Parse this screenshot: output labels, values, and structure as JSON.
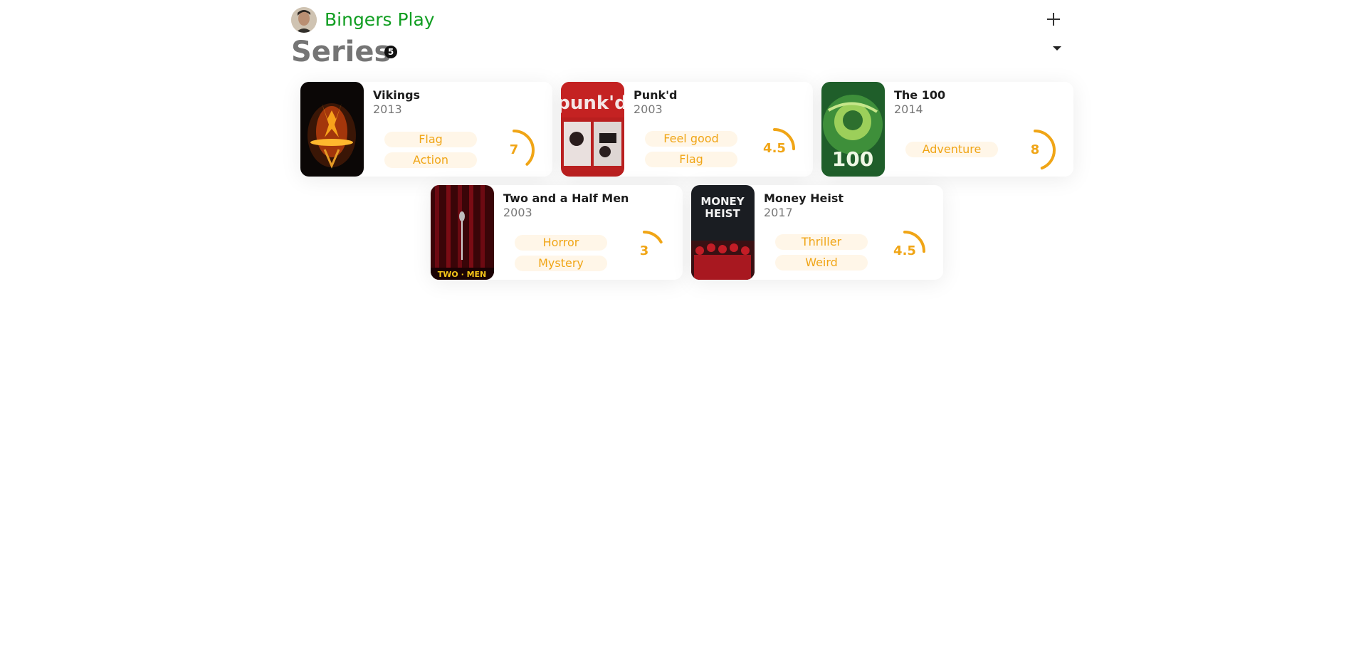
{
  "header": {
    "brand": "Bingers Play"
  },
  "page": {
    "title": "Series",
    "count": "5"
  },
  "series": [
    {
      "title": "Vikings",
      "year": "2013",
      "tags": [
        "Flag",
        "Action"
      ],
      "rating": "7",
      "rating_fraction": 0.38
    },
    {
      "title": "Punk'd",
      "year": "2003",
      "tags": [
        "Feel good",
        "Flag"
      ],
      "rating": "4.5",
      "rating_fraction": 0.25
    },
    {
      "title": "The 100",
      "year": "2014",
      "tags": [
        "Adventure"
      ],
      "rating": "8",
      "rating_fraction": 0.44
    },
    {
      "title": "Two and a Half Men",
      "year": "2003",
      "tags": [
        "Horror",
        "Mystery"
      ],
      "rating": "3",
      "rating_fraction": 0.17
    },
    {
      "title": "Money Heist",
      "year": "2017",
      "tags": [
        "Thriller",
        "Weird"
      ],
      "rating": "4.5",
      "rating_fraction": 0.25
    }
  ],
  "colors": {
    "brand": "#119e22",
    "accent": "#f0a516",
    "tag_bg": "#fff6e8",
    "title": "#757575"
  }
}
